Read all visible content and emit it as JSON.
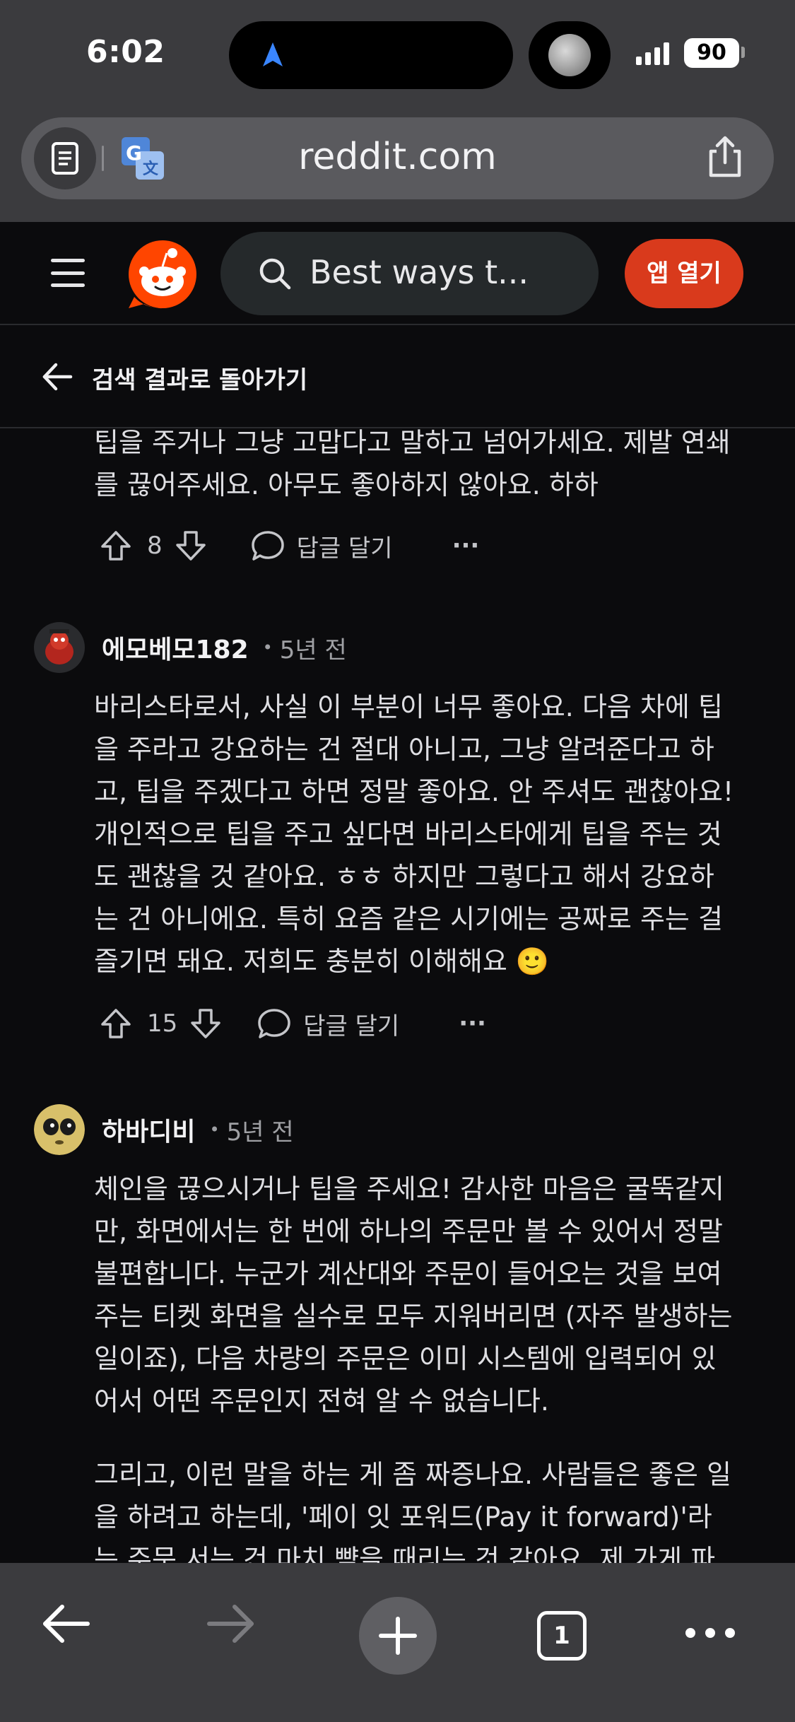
{
  "status_bar": {
    "time": "6:02",
    "battery": "90"
  },
  "browser": {
    "url": "reddit.com",
    "tab_count": "1"
  },
  "header": {
    "search_text": "Best ways t...",
    "open_app_label": "앱 열기"
  },
  "backbar": {
    "label": "검색 결과로 돌아가기"
  },
  "comments": [
    {
      "body_lines": [
        "팁을 주거나 그냥 고맙다고 말하고 넘어가세요. 제발 연쇄",
        "를 끊어주세요. 아무도 좋아하지 않아요. 하하"
      ],
      "votes": "8",
      "reply_label": "답글 달기",
      "more_label": "···"
    },
    {
      "username": "에모베모182",
      "dot": "•",
      "time": "5년 전",
      "body_lines": [
        "바리스타로서, 사실 이 부분이 너무 좋아요. 다음 차에 팁",
        "을 주라고 강요하는 건 절대 아니고, 그냥 알려준다고 하",
        "고, 팁을 주겠다고 하면 정말 좋아요. 안 주셔도 괜찮아요!",
        "개인적으로 팁을 주고 싶다면 바리스타에게 팁을 주는 것",
        "도 괜찮을 것 같아요. ㅎㅎ 하지만 그렇다고 해서 강요하",
        "는 건 아니에요. 특히 요즘 같은 시기에는 공짜로 주는 걸",
        "즐기면 돼요. 저희도 충분히 이해해요 🙂"
      ],
      "votes": "15",
      "reply_label": "답글 달기",
      "more_label": "···"
    },
    {
      "username": "하바디비",
      "dot": "•",
      "time": "5년 전",
      "body_lines": [
        "체인을 끊으시거나 팁을 주세요! 감사한 마음은 굴뚝같지",
        "만, 화면에서는 한 번에 하나의 주문만 볼 수 있어서 정말",
        "불편합니다. 누군가 계산대와 주문이 들어오는 것을 보여",
        "주는 티켓 화면을 실수로 모두 지워버리면 (자주 발생하는",
        "일이죠), 다음 차량의 주문은 이미 시스템에 입력되어 있",
        "어서 어떤 주문인지 전혀 알 수 없습니다."
      ],
      "body_lines_2": [
        "그리고, 이런 말을 하는 게 좀 짜증나요. 사람들은 좋은 일",
        "을 하려고 하는데, '페이 잇 포워드(Pay it forward)'라",
        "는 주문 서는 건 마치 뺨을 때리는 것 같아요. 제 가게 파"
      ]
    }
  ]
}
